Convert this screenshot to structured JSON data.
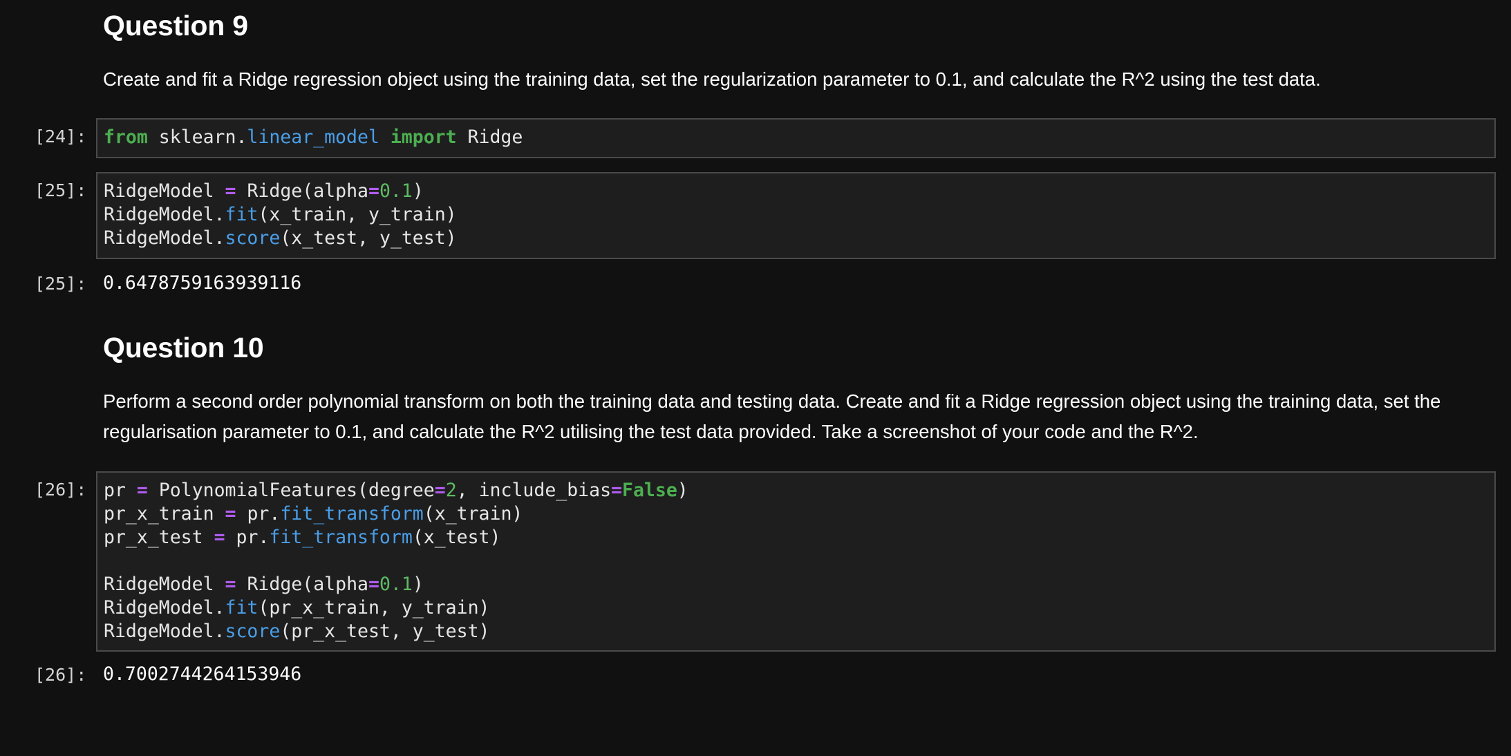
{
  "question9": {
    "heading": "Question 9",
    "text": "Create and fit a Ridge regression object using the training data, set the regularization parameter to 0.1, and calculate the R^2 using the test data."
  },
  "cell24": {
    "prompt": "[24]:",
    "code": {
      "from": "from",
      "module": " sklearn.",
      "submodule": "linear_model",
      "import": "import",
      "name": " Ridge"
    }
  },
  "cell25": {
    "prompt": "[25]:",
    "lines": [
      "RidgeModel = Ridge(alpha=0.1)",
      "RidgeModel.fit(x_train, y_train)",
      "RidgeModel.score(x_test, y_test)"
    ],
    "output_prompt": "[25]:",
    "output": "0.6478759163939116"
  },
  "question10": {
    "heading": "Question 10",
    "text": "Perform a second order polynomial transform on both the training data and testing data. Create and fit a Ridge regression object using the training data, set the regularisation parameter to 0.1, and calculate the R^2 utilising the test data provided. Take a screenshot of your code and the R^2."
  },
  "cell26": {
    "prompt": "[26]:",
    "lines": [
      "pr = PolynomialFeatures(degree=2, include_bias=False)",
      "pr_x_train = pr.fit_transform(x_train)",
      "pr_x_test = pr.fit_transform(x_test)",
      "",
      "RidgeModel = Ridge(alpha=0.1)",
      "RidgeModel.fit(pr_x_train, y_train)",
      "RidgeModel.score(pr_x_test, y_test)"
    ],
    "output_prompt": "[26]:",
    "output": "0.7002744264153946"
  },
  "colors": {
    "background": "#111111",
    "cell_background": "#1e1e1e",
    "keyword": "#4caf50",
    "attribute": "#4a9ee8",
    "operator": "#b15cf0",
    "number": "#5dbb63"
  }
}
